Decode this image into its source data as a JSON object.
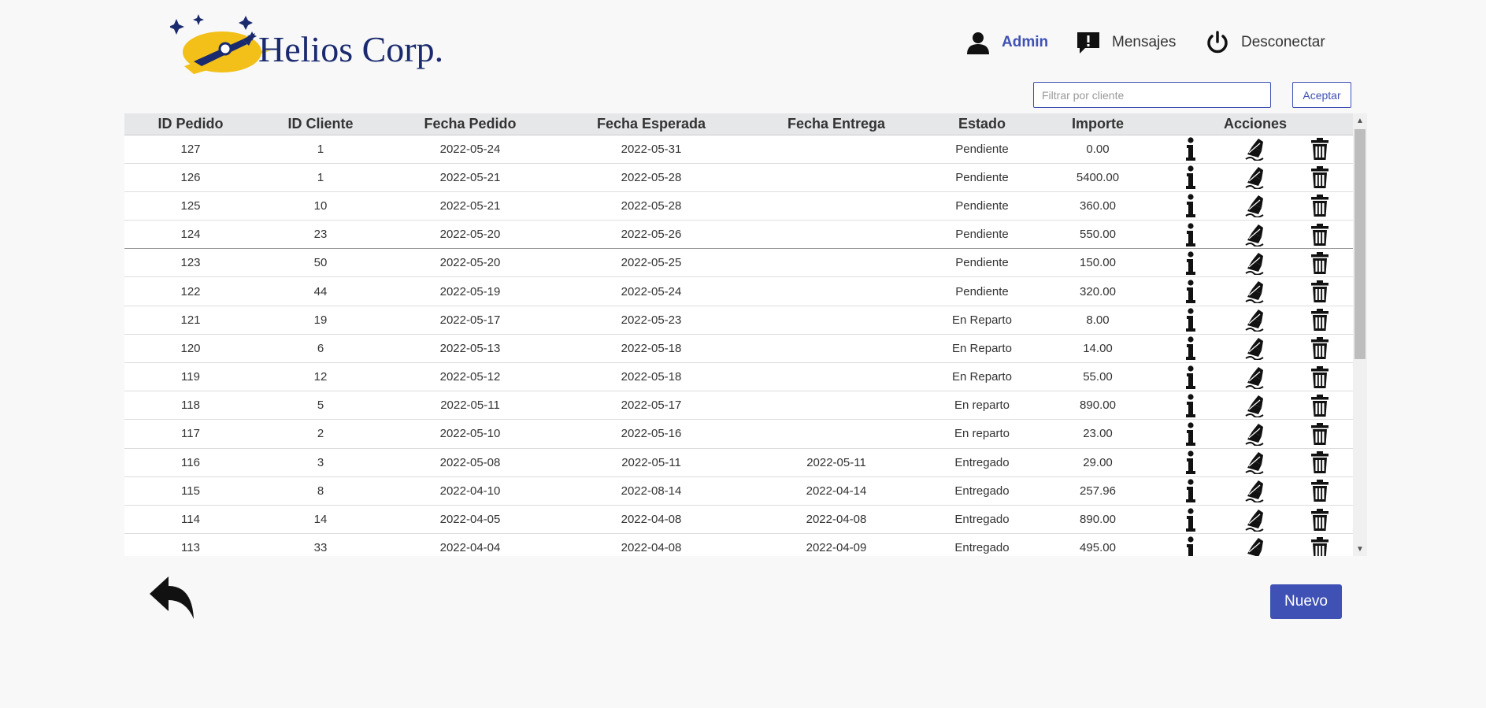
{
  "brand": {
    "name": "Helios Corp."
  },
  "nav": {
    "admin": "Admin",
    "messages": "Mensajes",
    "logout": "Desconectar"
  },
  "filter": {
    "placeholder": "Filtrar por cliente",
    "value": "",
    "button": "Aceptar"
  },
  "table": {
    "headers": [
      "ID Pedido",
      "ID Cliente",
      "Fecha Pedido",
      "Fecha Esperada",
      "Fecha Entrega",
      "Estado",
      "Importe",
      "Acciones"
    ],
    "rows": [
      [
        "127",
        "1",
        "2022-05-24",
        "2022-05-31",
        "",
        "Pendiente",
        "0.00"
      ],
      [
        "126",
        "1",
        "2022-05-21",
        "2022-05-28",
        "",
        "Pendiente",
        "5400.00"
      ],
      [
        "125",
        "10",
        "2022-05-21",
        "2022-05-28",
        "",
        "Pendiente",
        "360.00"
      ],
      [
        "124",
        "23",
        "2022-05-20",
        "2022-05-26",
        "",
        "Pendiente",
        "550.00"
      ],
      [
        "123",
        "50",
        "2022-05-20",
        "2022-05-25",
        "",
        "Pendiente",
        "150.00"
      ],
      [
        "122",
        "44",
        "2022-05-19",
        "2022-05-24",
        "",
        "Pendiente",
        "320.00"
      ],
      [
        "121",
        "19",
        "2022-05-17",
        "2022-05-23",
        "",
        "En Reparto",
        "8.00"
      ],
      [
        "120",
        "6",
        "2022-05-13",
        "2022-05-18",
        "",
        "En Reparto",
        "14.00"
      ],
      [
        "119",
        "12",
        "2022-05-12",
        "2022-05-18",
        "",
        "En Reparto",
        "55.00"
      ],
      [
        "118",
        "5",
        "2022-05-11",
        "2022-05-17",
        "",
        "En reparto",
        "890.00"
      ],
      [
        "117",
        "2",
        "2022-05-10",
        "2022-05-16",
        "",
        "En reparto",
        "23.00"
      ],
      [
        "116",
        "3",
        "2022-05-08",
        "2022-05-11",
        "2022-05-11",
        "Entregado",
        "29.00"
      ],
      [
        "115",
        "8",
        "2022-04-10",
        "2022-08-14",
        "2022-04-14",
        "Entregado",
        "257.96"
      ],
      [
        "114",
        "14",
        "2022-04-05",
        "2022-04-08",
        "2022-04-08",
        "Entregado",
        "890.00"
      ],
      [
        "113",
        "33",
        "2022-04-04",
        "2022-04-08",
        "2022-04-09",
        "Entregado",
        "495.00"
      ]
    ],
    "row_actions": [
      "info-icon",
      "edit-signature-icon",
      "trash-icon"
    ]
  },
  "footer": {
    "new_button": "Nuevo"
  },
  "colors": {
    "accent": "#3f51b5",
    "header_bg": "#e6e7e9",
    "brand_navy": "#1a2a6e",
    "logo_gold": "#f2c018"
  }
}
